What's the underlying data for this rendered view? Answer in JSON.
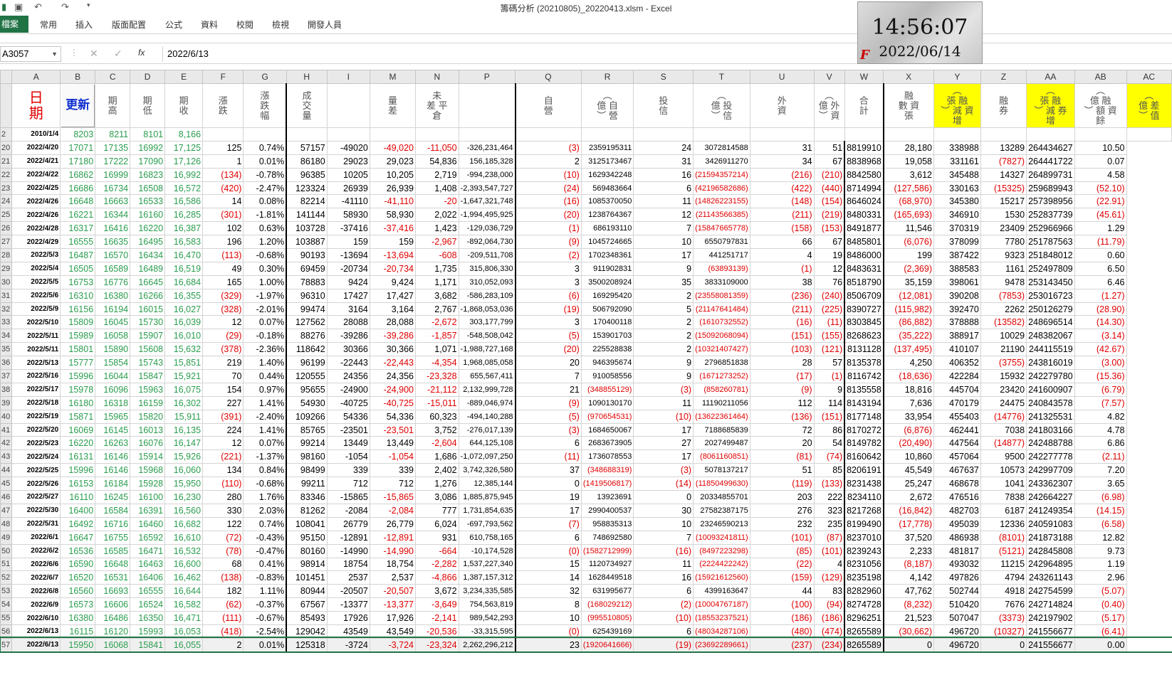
{
  "window": {
    "title": "籌碼分析 (20210805)_20220413.xlsm - Excel"
  },
  "ribbon": {
    "file": "檔案",
    "tabs": [
      "常用",
      "插入",
      "版面配置",
      "公式",
      "資料",
      "校閱",
      "檢視",
      "開發人員"
    ]
  },
  "formula_bar": {
    "name_box": "A3057",
    "fx": "fx",
    "value": "2022/6/13"
  },
  "clock": {
    "time": "14:56:07",
    "date": "2022/06/14",
    "mark": "F"
  },
  "columns": [
    "A",
    "B",
    "C",
    "D",
    "E",
    "F",
    "G",
    "H",
    "I",
    "M",
    "N",
    "P",
    "Q",
    "R",
    "S",
    "T",
    "U",
    "V",
    "W",
    "X",
    "Y",
    "Z",
    "AA",
    "AB",
    "AC"
  ],
  "headers": [
    "日\n期",
    "更新",
    "期\n高",
    "期\n低",
    "期\n收",
    "漲\n跌",
    "漲\n跌\n幅",
    "成\n交\n量",
    "",
    "量\n差",
    "未\n差 平\n倉",
    "",
    "自\n營",
    "︵\n億 自\n︶ 營",
    "投\n信",
    "︵\n億 投\n︶ 信",
    "外\n資",
    "︵\n億 外\n︶ 資",
    "合\n計",
    "融\n數 資\n張",
    "︵\n張 融\n︶ 減 資\n增",
    "融\n券",
    "︵\n張 融\n︶ 減 券\n增",
    "︵\n億 融\n︶ 額 資\n餘",
    "︵\n億 差\n︶ 值"
  ],
  "row2": {
    "rownum": "2",
    "A": "2010/1/4",
    "B": "8203",
    "C": "8211",
    "D": "8101",
    "E": "8,166"
  },
  "rows": [
    [
      "20",
      "2022/4/20",
      "17071",
      "17135",
      "16992",
      "17,125",
      "125",
      "0.74%",
      "57157",
      "-49020",
      "-49,020",
      "-11,050",
      "-326,231,464",
      "(3)",
      "2359195311",
      "24",
      "3072814588",
      "31",
      "51",
      "8819910",
      "28,180",
      "338988",
      "13289",
      "264434627",
      "10.50"
    ],
    [
      "21",
      "2022/4/21",
      "17180",
      "17222",
      "17090",
      "17,126",
      "1",
      "0.01%",
      "86180",
      "29023",
      "29,023",
      "54,836",
      "156,185,328",
      "2",
      "3125173467",
      "31",
      "3426911270",
      "34",
      "67",
      "8838968",
      "19,058",
      "331161",
      "(7827)",
      "264441722",
      "0.07"
    ],
    [
      "22",
      "2022/4/22",
      "16862",
      "16999",
      "16823",
      "16,992",
      "(134)",
      "-0.78%",
      "96385",
      "10205",
      "10,205",
      "2,719",
      "-994,238,000",
      "(10)",
      "1629342248",
      "16",
      "(21594357214)",
      "(216)",
      "(210)",
      "8842580",
      "3,612",
      "345488",
      "14327",
      "264899731",
      "4.58"
    ],
    [
      "23",
      "2022/4/25",
      "16686",
      "16734",
      "16508",
      "16,572",
      "(420)",
      "-2.47%",
      "123324",
      "26939",
      "26,939",
      "1,408",
      "-2,393,547,727",
      "(24)",
      "569483664",
      "6",
      "(42196582686)",
      "(422)",
      "(440)",
      "8714994",
      "(127,586)",
      "330163",
      "(15325)",
      "259689943",
      "(52.10)"
    ],
    [
      "24",
      "2022/4/26",
      "16648",
      "16663",
      "16533",
      "16,586",
      "14",
      "0.08%",
      "82214",
      "-41110",
      "-41,110",
      "-20",
      "-1,647,321,748",
      "(16)",
      "1085370050",
      "11",
      "(14826223155)",
      "(148)",
      "(154)",
      "8646024",
      "(68,970)",
      "345380",
      "15217",
      "257398956",
      "(22.91)"
    ],
    [
      "25",
      "2022/4/26",
      "16221",
      "16344",
      "16160",
      "16,285",
      "(301)",
      "-1.81%",
      "141144",
      "58930",
      "58,930",
      "2,022",
      "-1,994,495,925",
      "(20)",
      "1238764367",
      "12",
      "(21143566385)",
      "(211)",
      "(219)",
      "8480331",
      "(165,693)",
      "346910",
      "1530",
      "252837739",
      "(45.61)"
    ],
    [
      "26",
      "2022/4/28",
      "16317",
      "16416",
      "16220",
      "16,387",
      "102",
      "0.63%",
      "103728",
      "-37416",
      "-37,416",
      "1,423",
      "-129,036,729",
      "(1)",
      "686193110",
      "7",
      "(15847665778)",
      "(158)",
      "(153)",
      "8491877",
      "11,546",
      "370319",
      "23409",
      "252966966",
      "1.29"
    ],
    [
      "27",
      "2022/4/29",
      "16555",
      "16635",
      "16495",
      "16,583",
      "196",
      "1.20%",
      "103887",
      "159",
      "159",
      "-2,967",
      "-892,064,730",
      "(9)",
      "1045724665",
      "10",
      "6550797831",
      "66",
      "67",
      "8485801",
      "(6,076)",
      "378099",
      "7780",
      "251787563",
      "(11.79)"
    ],
    [
      "28",
      "2022/5/3",
      "16487",
      "16570",
      "16434",
      "16,470",
      "(113)",
      "-0.68%",
      "90193",
      "-13694",
      "-13,694",
      "-608",
      "-209,511,708",
      "(2)",
      "1702348361",
      "17",
      "441251717",
      "4",
      "19",
      "8486000",
      "199",
      "387422",
      "9323",
      "251848012",
      "0.60"
    ],
    [
      "29",
      "2022/5/4",
      "16505",
      "16589",
      "16489",
      "16,519",
      "49",
      "0.30%",
      "69459",
      "-20734",
      "-20,734",
      "1,735",
      "315,806,330",
      "3",
      "911902831",
      "9",
      "(63893139)",
      "(1)",
      "12",
      "8483631",
      "(2,369)",
      "388583",
      "1161",
      "252497809",
      "6.50"
    ],
    [
      "30",
      "2022/5/5",
      "16753",
      "16776",
      "16645",
      "16,684",
      "165",
      "1.00%",
      "78883",
      "9424",
      "9,424",
      "1,171",
      "310,052,093",
      "3",
      "3500208924",
      "35",
      "3833109000",
      "38",
      "76",
      "8518790",
      "35,159",
      "398061",
      "9478",
      "253143450",
      "6.46"
    ],
    [
      "31",
      "2022/5/6",
      "16310",
      "16380",
      "16266",
      "16,355",
      "(329)",
      "-1.97%",
      "96310",
      "17427",
      "17,427",
      "3,682",
      "-586,283,109",
      "(6)",
      "169295420",
      "2",
      "(23558081359)",
      "(236)",
      "(240)",
      "8506709",
      "(12,081)",
      "390208",
      "(7853)",
      "253016723",
      "(1.27)"
    ],
    [
      "32",
      "2022/5/9",
      "16156",
      "16194",
      "16015",
      "16,027",
      "(328)",
      "-2.01%",
      "99474",
      "3164",
      "3,164",
      "2,767",
      "-1,868,053,036",
      "(19)",
      "506792090",
      "5",
      "(21147641484)",
      "(211)",
      "(225)",
      "8390727",
      "(115,982)",
      "392470",
      "2262",
      "250126279",
      "(28.90)"
    ],
    [
      "33",
      "2022/5/10",
      "15809",
      "16045",
      "15730",
      "16,039",
      "12",
      "0.07%",
      "127562",
      "28088",
      "28,088",
      "-2,672",
      "303,177,799",
      "3",
      "170400118",
      "2",
      "(1610732552)",
      "(16)",
      "(11)",
      "8303845",
      "(86,882)",
      "378888",
      "(13582)",
      "248696514",
      "(14.30)"
    ],
    [
      "34",
      "2022/5/11",
      "15989",
      "16058",
      "15907",
      "16,010",
      "(29)",
      "-0.18%",
      "88276",
      "-39286",
      "-39,286",
      "-1,857",
      "-548,508,042",
      "(5)",
      "153901703",
      "2",
      "(15092068094)",
      "(151)",
      "(155)",
      "8268623",
      "(35,222)",
      "388917",
      "10029",
      "248382067",
      "(3.14)"
    ],
    [
      "35",
      "2022/5/11",
      "15801",
      "15890",
      "15608",
      "15,632",
      "(378)",
      "-2.36%",
      "118642",
      "30366",
      "30,366",
      "1,071",
      "-1,988,727,168",
      "(20)",
      "225528838",
      "2",
      "(10321407427)",
      "(103)",
      "(121)",
      "8131128",
      "(137,495)",
      "410107",
      "21190",
      "244115519",
      "(42.67)"
    ],
    [
      "36",
      "2022/5/13",
      "15777",
      "15854",
      "15743",
      "15,851",
      "219",
      "1.40%",
      "96199",
      "-22443",
      "-22,443",
      "-4,354",
      "1,968,085,058",
      "20",
      "946395674",
      "9",
      "2796851838",
      "28",
      "57",
      "8135378",
      "4,250",
      "406352",
      "(3755)",
      "243816019",
      "(3.00)"
    ],
    [
      "37",
      "2022/5/16",
      "15996",
      "16044",
      "15847",
      "15,921",
      "70",
      "0.44%",
      "120555",
      "24356",
      "24,356",
      "-23,328",
      "655,567,411",
      "7",
      "910058556",
      "9",
      "(1671273252)",
      "(17)",
      "(1)",
      "8116742",
      "(18,636)",
      "422284",
      "15932",
      "242279780",
      "(15.36)"
    ],
    [
      "38",
      "2022/5/17",
      "15978",
      "16096",
      "15963",
      "16,075",
      "154",
      "0.97%",
      "95655",
      "-24900",
      "-24,900",
      "-21,112",
      "2,132,999,728",
      "21",
      "(348855129)",
      "(3)",
      "(858260781)",
      "(9)",
      "9",
      "8135558",
      "18,816",
      "445704",
      "23420",
      "241600907",
      "(6.79)"
    ],
    [
      "39",
      "2022/5/18",
      "16180",
      "16318",
      "16159",
      "16,302",
      "227",
      "1.41%",
      "54930",
      "-40725",
      "-40,725",
      "-15,011",
      "-889,046,974",
      "(9)",
      "1090130170",
      "11",
      "11190211056",
      "112",
      "114",
      "8143194",
      "7,636",
      "470179",
      "24475",
      "240843578",
      "(7.57)"
    ],
    [
      "40",
      "2022/5/19",
      "15871",
      "15965",
      "15820",
      "15,911",
      "(391)",
      "-2.40%",
      "109266",
      "54336",
      "54,336",
      "60,323",
      "-494,140,288",
      "(5)",
      "(970654531)",
      "(10)",
      "(13622361464)",
      "(136)",
      "(151)",
      "8177148",
      "33,954",
      "455403",
      "(14776)",
      "241325531",
      "4.82"
    ],
    [
      "41",
      "2022/5/20",
      "16069",
      "16145",
      "16013",
      "16,135",
      "224",
      "1.41%",
      "85765",
      "-23501",
      "-23,501",
      "3,752",
      "-276,017,139",
      "(3)",
      "1684650067",
      "17",
      "7188685839",
      "72",
      "86",
      "8170272",
      "(6,876)",
      "462441",
      "7038",
      "241803166",
      "4.78"
    ],
    [
      "42",
      "2022/5/23",
      "16220",
      "16263",
      "16076",
      "16,147",
      "12",
      "0.07%",
      "99214",
      "13449",
      "13,449",
      "-2,604",
      "644,125,108",
      "6",
      "2683673905",
      "27",
      "2027499487",
      "20",
      "54",
      "8149782",
      "(20,490)",
      "447564",
      "(14877)",
      "242488788",
      "6.86"
    ],
    [
      "43",
      "2022/5/24",
      "16131",
      "16146",
      "15914",
      "15,926",
      "(221)",
      "-1.37%",
      "98160",
      "-1054",
      "-1,054",
      "1,686",
      "-1,072,097,250",
      "(11)",
      "1736078553",
      "17",
      "(8061160851)",
      "(81)",
      "(74)",
      "8160642",
      "10,860",
      "457064",
      "9500",
      "242277778",
      "(2.11)"
    ],
    [
      "44",
      "2022/5/25",
      "15996",
      "16146",
      "15968",
      "16,060",
      "134",
      "0.84%",
      "98499",
      "339",
      "339",
      "2,402",
      "3,742,326,580",
      "37",
      "(348688319)",
      "(3)",
      "5078137217",
      "51",
      "85",
      "8206191",
      "45,549",
      "467637",
      "10573",
      "242997709",
      "7.20"
    ],
    [
      "45",
      "2022/5/26",
      "16153",
      "16184",
      "15928",
      "15,950",
      "(110)",
      "-0.68%",
      "99211",
      "712",
      "712",
      "1,276",
      "12,385,144",
      "0",
      "(1419506817)",
      "(14)",
      "(11850499630)",
      "(119)",
      "(133)",
      "8231438",
      "25,247",
      "468678",
      "1041",
      "243362307",
      "3.65"
    ],
    [
      "46",
      "2022/5/27",
      "16110",
      "16245",
      "16100",
      "16,230",
      "280",
      "1.76%",
      "83346",
      "-15865",
      "-15,865",
      "3,086",
      "1,885,875,945",
      "19",
      "13923691",
      "0",
      "20334855701",
      "203",
      "222",
      "8234110",
      "2,672",
      "476516",
      "7838",
      "242664227",
      "(6.98)"
    ],
    [
      "47",
      "2022/5/30",
      "16400",
      "16584",
      "16391",
      "16,560",
      "330",
      "2.03%",
      "81262",
      "-2084",
      "-2,084",
      "777",
      "1,731,854,635",
      "17",
      "2990400537",
      "30",
      "27582387175",
      "276",
      "323",
      "8217268",
      "(16,842)",
      "482703",
      "6187",
      "241249354",
      "(14.15)"
    ],
    [
      "48",
      "2022/5/31",
      "16492",
      "16716",
      "16460",
      "16,682",
      "122",
      "0.74%",
      "108041",
      "26779",
      "26,779",
      "6,024",
      "-697,793,562",
      "(7)",
      "958835313",
      "10",
      "23246590213",
      "232",
      "235",
      "8199490",
      "(17,778)",
      "495039",
      "12336",
      "240591083",
      "(6.58)"
    ],
    [
      "49",
      "2022/6/1",
      "16647",
      "16755",
      "16592",
      "16,610",
      "(72)",
      "-0.43%",
      "95150",
      "-12891",
      "-12,891",
      "931",
      "610,758,165",
      "6",
      "748692580",
      "7",
      "(10093241811)",
      "(101)",
      "(87)",
      "8237010",
      "37,520",
      "486938",
      "(8101)",
      "241873188",
      "12.82"
    ],
    [
      "50",
      "2022/6/2",
      "16536",
      "16585",
      "16471",
      "16,532",
      "(78)",
      "-0.47%",
      "80160",
      "-14990",
      "-14,990",
      "-664",
      "-10,174,528",
      "(0)",
      "(1582712999)",
      "(16)",
      "(8497223298)",
      "(85)",
      "(101)",
      "8239243",
      "2,233",
      "481817",
      "(5121)",
      "242845808",
      "9.73"
    ],
    [
      "51",
      "2022/6/6",
      "16590",
      "16648",
      "16463",
      "16,600",
      "68",
      "0.41%",
      "98914",
      "18754",
      "18,754",
      "-2,282",
      "1,537,227,340",
      "15",
      "1120734927",
      "11",
      "(2224422242)",
      "(22)",
      "4",
      "8231056",
      "(8,187)",
      "493032",
      "11215",
      "242964895",
      "1.19"
    ],
    [
      "52",
      "2022/6/7",
      "16520",
      "16531",
      "16406",
      "16,462",
      "(138)",
      "-0.83%",
      "101451",
      "2537",
      "2,537",
      "-4,866",
      "1,387,157,312",
      "14",
      "1628449518",
      "16",
      "(15921612560)",
      "(159)",
      "(129)",
      "8235198",
      "4,142",
      "497826",
      "4794",
      "243261143",
      "2.96"
    ],
    [
      "53",
      "2022/6/8",
      "16560",
      "16693",
      "16555",
      "16,644",
      "182",
      "1.11%",
      "80944",
      "-20507",
      "-20,507",
      "3,672",
      "3,234,335,585",
      "32",
      "631995677",
      "6",
      "4399163647",
      "44",
      "83",
      "8282960",
      "47,762",
      "502744",
      "4918",
      "242754599",
      "(5.07)"
    ],
    [
      "54",
      "2022/6/9",
      "16573",
      "16606",
      "16524",
      "16,582",
      "(62)",
      "-0.37%",
      "67567",
      "-13377",
      "-13,377",
      "-3,649",
      "754,563,819",
      "8",
      "(168029212)",
      "(2)",
      "(10004767187)",
      "(100)",
      "(94)",
      "8274728",
      "(8,232)",
      "510420",
      "7676",
      "242714824",
      "(0.40)"
    ],
    [
      "55",
      "2022/6/10",
      "16380",
      "16486",
      "16350",
      "16,471",
      "(111)",
      "-0.67%",
      "85493",
      "17926",
      "17,926",
      "-2,141",
      "989,542,293",
      "10",
      "(995510805)",
      "(10)",
      "(18553237521)",
      "(186)",
      "(186)",
      "8296251",
      "21,523",
      "507047",
      "(3373)",
      "242197902",
      "(5.17)"
    ],
    [
      "56",
      "2022/6/13",
      "16115",
      "16120",
      "15993",
      "16,053",
      "(418)",
      "-2.54%",
      "129042",
      "43549",
      "43,549",
      "-20,536",
      "-33,315,595",
      "(0)",
      "625439169",
      "6",
      "(48034287106)",
      "(480)",
      "(474)",
      "8265589",
      "(30,662)",
      "496720",
      "(10327)",
      "241556677",
      "(6.41)"
    ],
    [
      "57",
      "2022/6/13",
      "15950",
      "16068",
      "15841",
      "16,055",
      "2",
      "0.01%",
      "125318",
      "-3724",
      "-3,724",
      "-23,324",
      "2,262,296,212",
      "23",
      "(1920641666)",
      "(19)",
      "(23692289661)",
      "(237)",
      "(234)",
      "8265589",
      "0",
      "496720",
      "0",
      "241556677",
      "0.00"
    ]
  ]
}
